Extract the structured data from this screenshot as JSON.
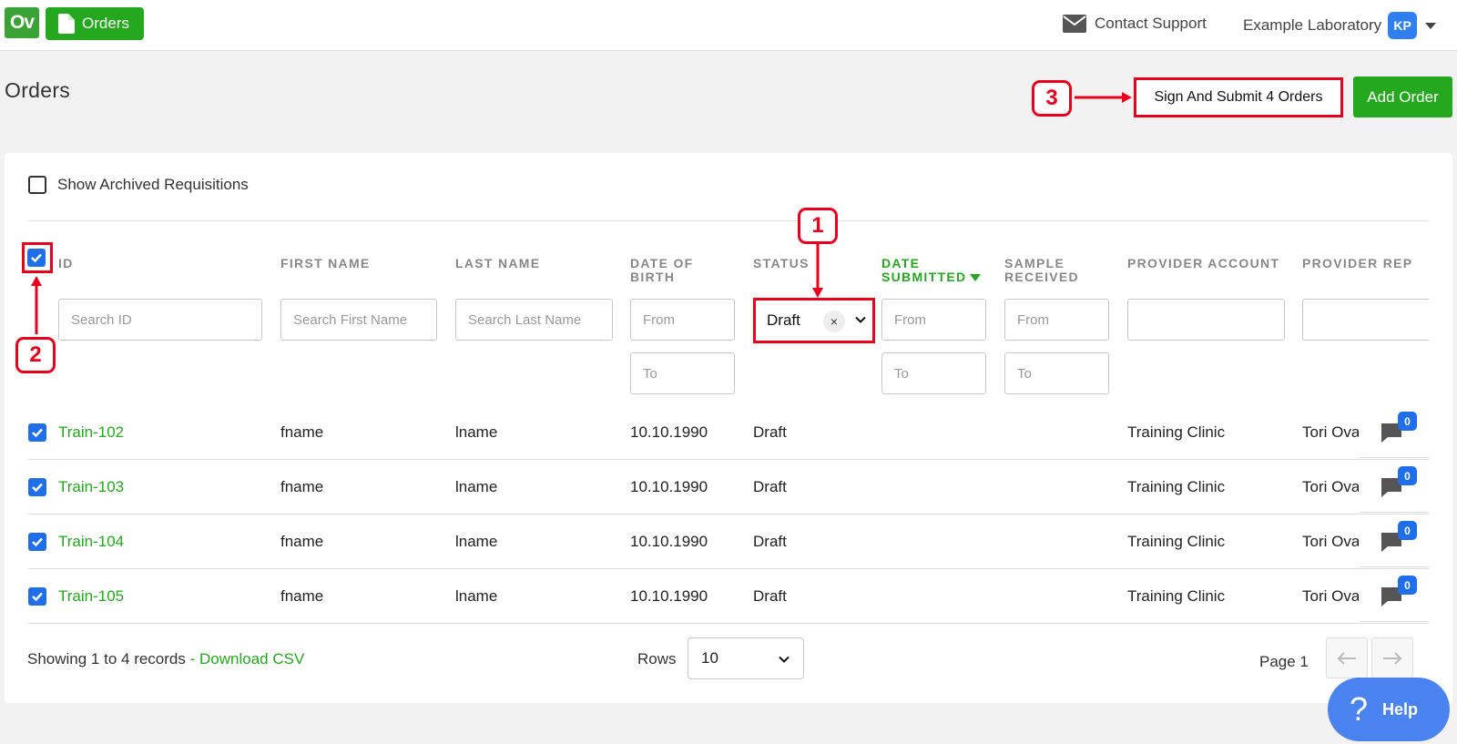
{
  "app": {
    "logo_text": "Ov",
    "nav_orders": "Orders",
    "contact_support": "Contact Support",
    "lab_name": "Example Laboratory",
    "avatar_initials": "KP"
  },
  "page": {
    "title": "Orders",
    "sign_submit_label": "Sign And Submit 4 Orders",
    "add_order_label": "Add Order"
  },
  "filters": {
    "show_archived_label": "Show Archived Requisitions",
    "show_archived_checked": false,
    "search_id_placeholder": "Search ID",
    "search_first_placeholder": "Search First Name",
    "search_last_placeholder": "Search Last Name",
    "from_placeholder": "From",
    "to_placeholder": "To",
    "status_value": "Draft",
    "status_clear": "×"
  },
  "columns": {
    "id": "ID",
    "first_name": "FIRST NAME",
    "last_name": "LAST NAME",
    "dob_line1": "DATE OF",
    "dob_line2": "BIRTH",
    "status": "STATUS",
    "date_submitted_line1": "DATE",
    "date_submitted_line2": "SUBMITTED",
    "sample_received_line1": "SAMPLE",
    "sample_received_line2": "RECEIVED",
    "provider_account": "PROVIDER ACCOUNT",
    "provider_rep": "PROVIDER REP"
  },
  "rows": [
    {
      "id": "Train-102",
      "first": "fname",
      "last": "lname",
      "dob": "10.10.1990",
      "status": "Draft",
      "account": "Training Clinic",
      "rep": "Tori Ova",
      "messages": "0"
    },
    {
      "id": "Train-103",
      "first": "fname",
      "last": "lname",
      "dob": "10.10.1990",
      "status": "Draft",
      "account": "Training Clinic",
      "rep": "Tori Ova",
      "messages": "0"
    },
    {
      "id": "Train-104",
      "first": "fname",
      "last": "lname",
      "dob": "10.10.1990",
      "status": "Draft",
      "account": "Training Clinic",
      "rep": "Tori Ova",
      "messages": "0"
    },
    {
      "id": "Train-105",
      "first": "fname",
      "last": "lname",
      "dob": "10.10.1990",
      "status": "Draft",
      "account": "Training Clinic",
      "rep": "Tori Ova",
      "messages": "0"
    }
  ],
  "footer": {
    "showing": "Showing 1 to 4 records",
    "download": "- Download CSV",
    "rows_label": "Rows",
    "rows_value": "10",
    "page_label": "Page 1",
    "help_label": "Help",
    "help_glyph": "?"
  },
  "annotations": [
    "1",
    "2",
    "3"
  ],
  "colors": {
    "brand_green": "#24a81d",
    "checkbox_blue": "#1f6feb",
    "annotation_red": "#e8001c"
  }
}
